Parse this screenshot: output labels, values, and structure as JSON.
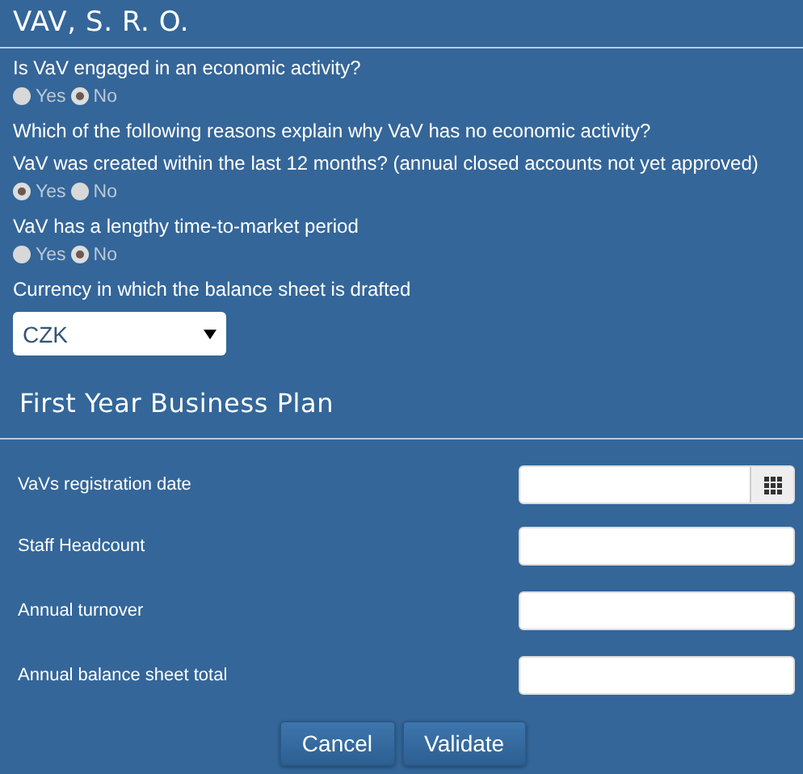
{
  "title": "VAV, S. R. O.",
  "questions": [
    {
      "kind": "radio",
      "label": "Is VaV engaged in an economic activity?",
      "options": [
        {
          "label": "Yes",
          "selected": false
        },
        {
          "label": "No",
          "selected": true
        }
      ]
    },
    {
      "kind": "text",
      "label": "Which of the following reasons explain why VaV has no economic activity?"
    },
    {
      "kind": "radio",
      "label": "VaV was created within the last 12 months? (annual closed accounts not yet approved)",
      "options": [
        {
          "label": "Yes",
          "selected": true
        },
        {
          "label": "No",
          "selected": false
        }
      ]
    },
    {
      "kind": "radio",
      "label": "VaV has a lengthy time-to-market period",
      "options": [
        {
          "label": "Yes",
          "selected": false
        },
        {
          "label": "No",
          "selected": true
        }
      ]
    },
    {
      "kind": "select",
      "label": "Currency in which the balance sheet is drafted",
      "value": "CZK"
    }
  ],
  "section": {
    "title": "First Year Business Plan"
  },
  "fields": [
    {
      "kind": "date",
      "label": "VaVs registration date"
    },
    {
      "kind": "text",
      "label": "Staff Headcount"
    },
    {
      "kind": "text",
      "label": "Annual turnover"
    },
    {
      "kind": "text",
      "label": "Annual balance sheet total"
    }
  ],
  "buttons": [
    "Cancel",
    "Validate"
  ]
}
